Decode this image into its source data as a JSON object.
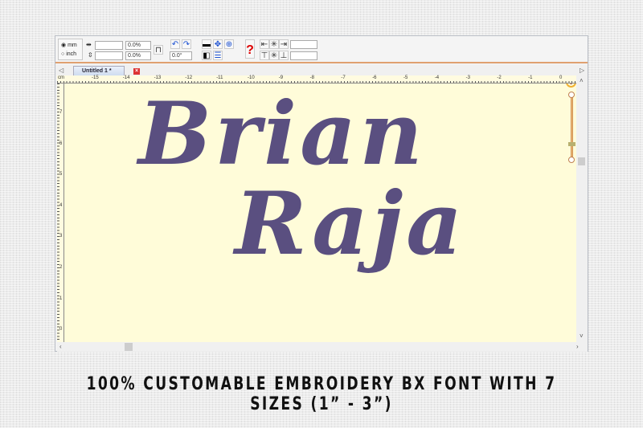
{
  "toolbar": {
    "unit_mm": "mm",
    "unit_inch": "inch",
    "unit_selected": "mm",
    "width_value": "",
    "height_value": "",
    "width_pct": "0.0%",
    "height_pct": "0.0%",
    "rotation": "0.0°",
    "field_right_1": "",
    "field_right_2": ""
  },
  "tabs": [
    {
      "label": "Untitled 1 *"
    }
  ],
  "ruler": {
    "unit": "cm",
    "top_labels": [
      "-15",
      "-14",
      "-13",
      "-12",
      "-11",
      "-10",
      "-9",
      "-8",
      "-7",
      "-6",
      "-5",
      "-4",
      "-3",
      "-2",
      "-1",
      "0"
    ],
    "left_labels": [
      "7",
      "6",
      "5",
      "4",
      "3",
      "2",
      "1",
      "0"
    ]
  },
  "design": {
    "line1": "Brian",
    "line2": "Raja",
    "thread_color": "#5a4f80",
    "background_color": "#fffcd9"
  },
  "caption": "100% CUSTOMABLE EMBROIDERY BX FONT WITH 7 SIZES (1” -  3”)"
}
